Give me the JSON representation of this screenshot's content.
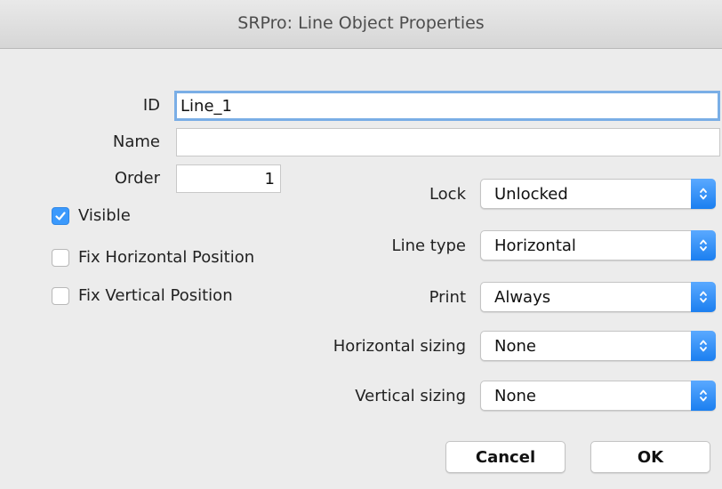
{
  "window": {
    "title": "SRPro: Line Object Properties"
  },
  "fields": {
    "id": {
      "label": "ID",
      "value": "Line_1"
    },
    "name": {
      "label": "Name",
      "value": ""
    },
    "order": {
      "label": "Order",
      "value": "1"
    }
  },
  "checks": {
    "visible": {
      "label": "Visible",
      "checked": true
    },
    "fix_h": {
      "label": "Fix Horizontal Position",
      "checked": false
    },
    "fix_v": {
      "label": "Fix Vertical Position",
      "checked": false
    }
  },
  "popups": {
    "lock": {
      "label": "Lock",
      "value": "Unlocked"
    },
    "line_type": {
      "label": "Line type",
      "value": "Horizontal"
    },
    "print": {
      "label": "Print",
      "value": "Always"
    },
    "h_sizing": {
      "label": "Horizontal sizing",
      "value": "None"
    },
    "v_sizing": {
      "label": "Vertical sizing",
      "value": "None"
    }
  },
  "buttons": {
    "cancel": "Cancel",
    "ok": "OK"
  },
  "colors": {
    "accent": "#3b99fc",
    "focus_ring": "#7aaee6",
    "window_bg": "#ececec"
  },
  "icons": {
    "check": "checkmark-icon",
    "popup": "up-down-arrows-icon"
  }
}
